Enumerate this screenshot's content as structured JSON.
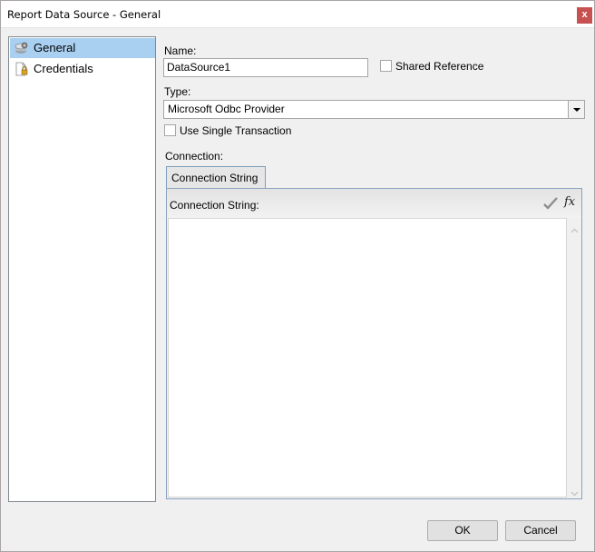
{
  "window": {
    "title": "Report Data Source - General",
    "close_glyph": "x"
  },
  "sidebar": {
    "items": [
      {
        "label": "General",
        "icon": "datasource-gear-icon",
        "selected": true
      },
      {
        "label": "Credentials",
        "icon": "document-lock-icon",
        "selected": false
      }
    ]
  },
  "form": {
    "name_label": "Name:",
    "name_value": "DataSource1",
    "shared_reference_label": "Shared Reference",
    "shared_reference_checked": false,
    "type_label": "Type:",
    "type_value": "Microsoft Odbc Provider",
    "use_single_transaction_label": "Use Single Transaction",
    "use_single_transaction_checked": false,
    "connection_label": "Connection:"
  },
  "connection": {
    "tab_label": "Connection String",
    "field_label": "Connection String:",
    "value": "",
    "validate_icon": "checkmark-icon",
    "expression_icon": "fx-icon",
    "fx_glyph": "fx"
  },
  "footer": {
    "ok_label": "OK",
    "cancel_label": "Cancel"
  },
  "colors": {
    "selection": "#a9d0f1",
    "close_button": "#c75050",
    "tab_border": "#7f9db9"
  }
}
